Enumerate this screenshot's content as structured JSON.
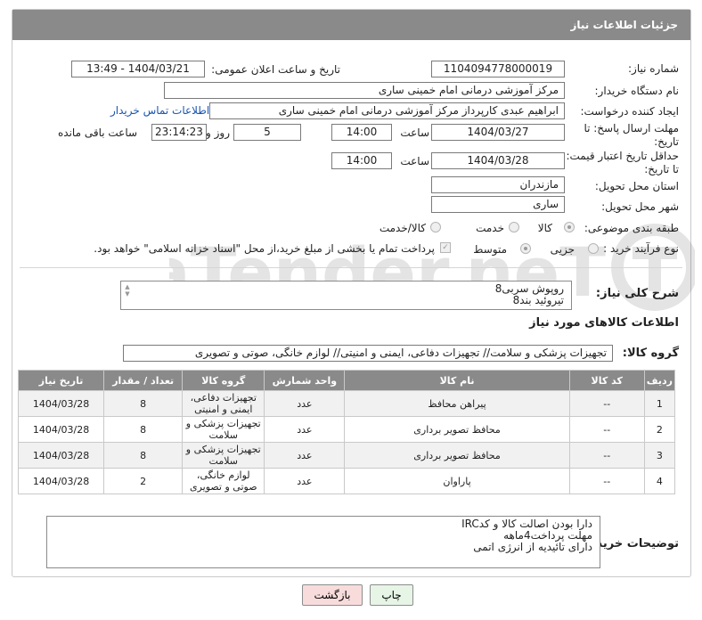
{
  "panel": {
    "title": "جزئیات اطلاعات نیاز"
  },
  "form": {
    "need_number": {
      "label": "شماره نیاز:",
      "value": "1104094778000019"
    },
    "announce_datetime": {
      "label": "تاریخ و ساعت اعلان عمومی:",
      "value": "1404/03/21 - 13:49"
    },
    "buyer_org": {
      "label": "نام دستگاه خریدار:",
      "value": "مرکز آموزشی درمانی امام خمینی ساری"
    },
    "requester": {
      "label": "ایجاد کننده درخواست:",
      "value": "ابراهیم عبدی کارپرداز مرکز آموزشی درمانی امام خمینی ساری",
      "contact_link": "اطلاعات تماس خریدار"
    },
    "reply_deadline": {
      "label_line1": "مهلت ارسال پاسخ: تا",
      "label_line2": "تاریخ:",
      "date": "1404/03/27",
      "time_label": "ساعت",
      "time": "14:00",
      "days": "5",
      "days_label": "روز و",
      "remaining": "23:14:23",
      "remaining_label": "ساعت باقی مانده"
    },
    "price_validity": {
      "label_line1": "حداقل تاریخ اعتبار قیمت:",
      "label_line2": "تا تاریخ:",
      "date": "1404/03/28",
      "time_label": "ساعت",
      "time": "14:00"
    },
    "delivery_province": {
      "label": "استان محل تحویل:",
      "value": "مازندران"
    },
    "delivery_city": {
      "label": "شهر محل تحویل:",
      "value": "ساری"
    },
    "category": {
      "label": "طبقه بندی موضوعی:",
      "options": [
        "کالا",
        "خدمت",
        "کالا/خدمت"
      ],
      "selected": "کالا"
    },
    "process_type": {
      "label": "نوع فرآیند خرید :",
      "options": [
        "جزیی",
        "متوسط"
      ],
      "selected": "متوسط",
      "payment_note": "پرداخت تمام یا بخشی از مبلغ خرید،از محل \"اسناد خزانه اسلامی\" خواهد بود."
    }
  },
  "summary": {
    "label": "شرح کلی نیاز:",
    "lines": [
      "روپوش سربی8",
      "تیروئید بند8"
    ]
  },
  "goods_section": {
    "title": "اطلاعات کالاهای مورد نیاز",
    "group_label": "گروه کالا:",
    "group_value": "تجهیزات پزشکی و سلامت// تجهیزات دفاعی، ایمنی و امنیتی// لوازم خانگی، صوتی و تصویری"
  },
  "table": {
    "headers": [
      "ردیف",
      "کد کالا",
      "نام کالا",
      "واحد شمارش",
      "گروه کالا",
      "تعداد / مقدار",
      "تاریخ نیاز"
    ],
    "rows": [
      {
        "row": "1",
        "code": "--",
        "name": "پیراهن محافظ",
        "unit": "عدد",
        "group": "تجهیزات دفاعی، ایمنی و امنیتی",
        "qty": "8",
        "date": "1404/03/28"
      },
      {
        "row": "2",
        "code": "--",
        "name": "محافظ تصویر برداری",
        "unit": "عدد",
        "group": "تجهیزات پزشکی و سلامت",
        "qty": "8",
        "date": "1404/03/28"
      },
      {
        "row": "3",
        "code": "--",
        "name": "محافظ تصویر برداری",
        "unit": "عدد",
        "group": "تجهیزات پزشکی و سلامت",
        "qty": "8",
        "date": "1404/03/28"
      },
      {
        "row": "4",
        "code": "--",
        "name": "پاراوان",
        "unit": "عدد",
        "group": "لوازم خانگی، صوتی و تصویری",
        "qty": "2",
        "date": "1404/03/28"
      }
    ]
  },
  "buyer_notes": {
    "label": "توضیحات خریدار:",
    "lines": [
      "دارا بودن اصالت کالا و کدIRC",
      "مهلت پرداخت4ماهه",
      "دارای تائیدیه از انرژی اتمی"
    ]
  },
  "buttons": {
    "print": "چاپ",
    "back": "بازگشت"
  },
  "watermark": {
    "text": "AriaTender.neT"
  },
  "colors": {
    "header_bg": "#8a8a8a",
    "link": "#1a55b0",
    "print_btn": "#e6f5e6",
    "back_btn": "#f8dcdc"
  }
}
